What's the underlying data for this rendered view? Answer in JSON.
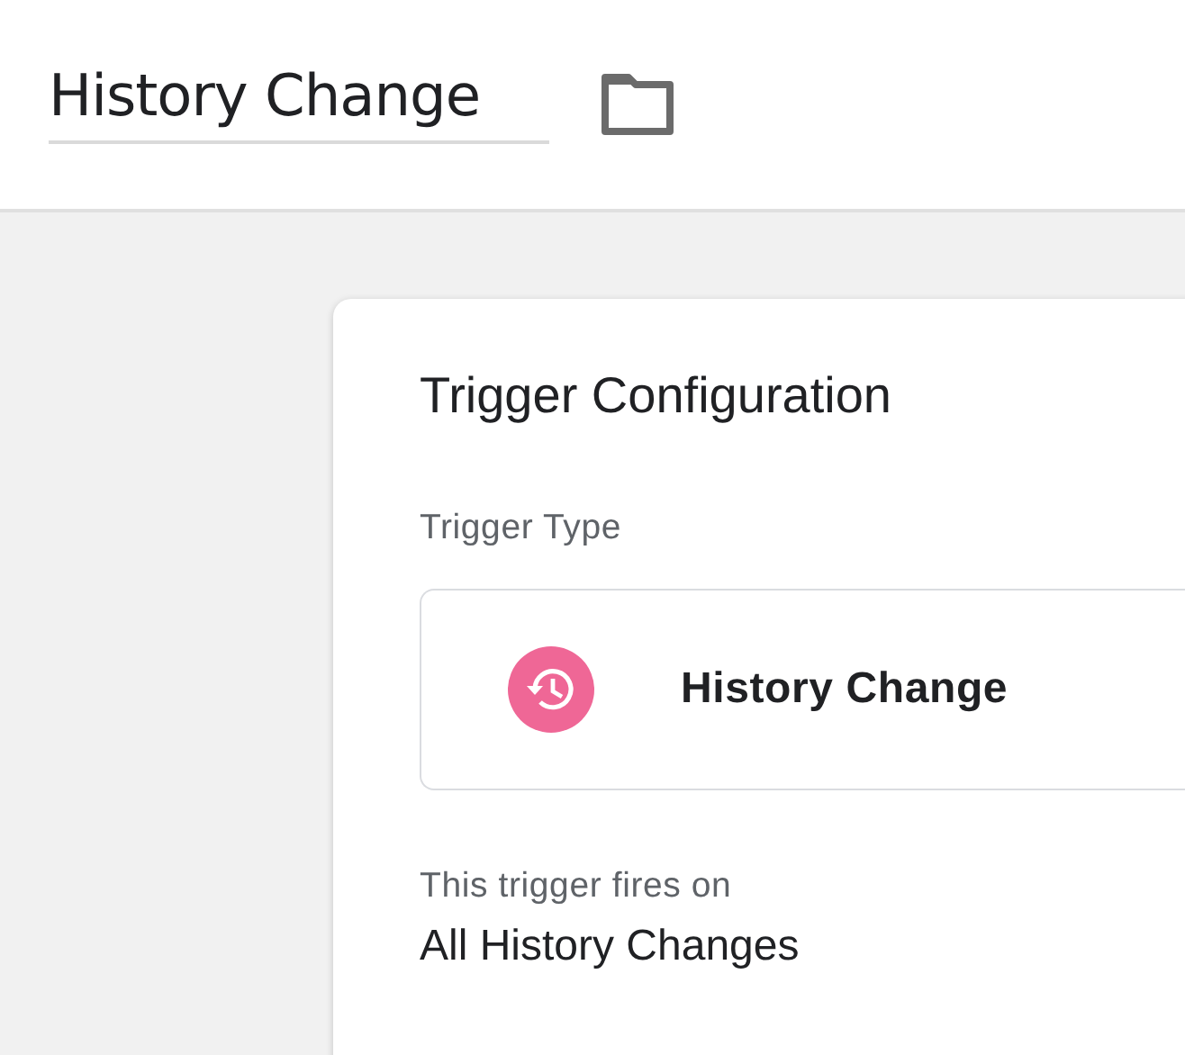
{
  "header": {
    "name_field": {
      "value": "History Change"
    }
  },
  "card": {
    "title": "Trigger Configuration",
    "trigger_type": {
      "label": "Trigger Type",
      "name": "History Change"
    },
    "fires_on": {
      "label": "This trigger fires on",
      "value": "All History Changes"
    }
  }
}
